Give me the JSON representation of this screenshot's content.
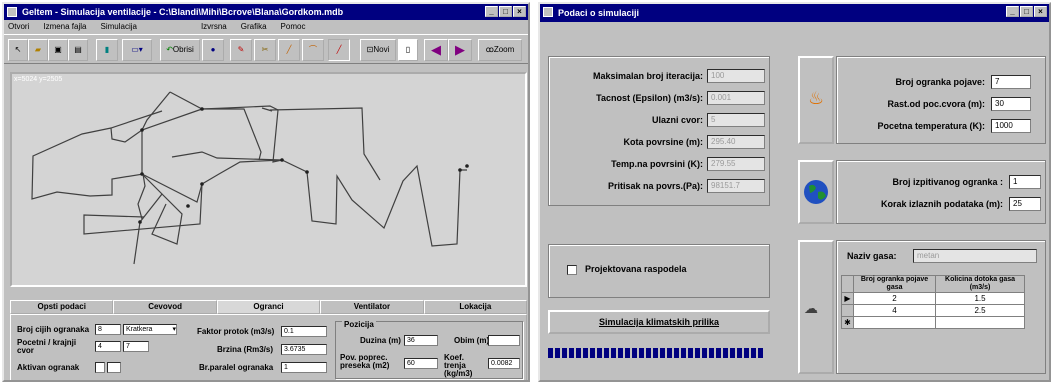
{
  "left_window": {
    "title": "Geltem - Simulacija ventilacije - C:\\Blandi\\Mihi\\Bcrove\\Blana\\Gordkom.mdb",
    "menu": [
      "Otvori",
      "Izmena fajla",
      "Simulacija",
      "Izvrsna",
      "Grafika",
      "Pomoc"
    ],
    "toolbar": {
      "obrisi_label": "Obrisi",
      "novi_label": "Novi",
      "zoom_label": "Zoom"
    },
    "coord_readout": "x=5024 y=2505",
    "tabs": [
      "Opsti podaci",
      "Cevovod",
      "Ogranci",
      "Ventilator",
      "Lokacija"
    ],
    "active_tab": 2,
    "panel": {
      "broj_cijih_ogranaka_label": "Broj cijih ogranaka",
      "broj_cijih_ogranaka_value": "8",
      "combo_value": "Kratkera",
      "pocetni_krajnji_label": "Pocetni / krajnji cvor",
      "pocetni_value": "4",
      "krajnji_value": "7",
      "aktivan_label": "Aktivan ogranak",
      "faktor_label": "Faktor protok (m3/s)",
      "faktor_value": "0.1",
      "brzina_label": "Brzina (Rm3/s)",
      "brzina_value": "3.6735",
      "br_paralel_label": "Br.paralel ogranaka",
      "br_paralel_value": "1",
      "pozicija_label": "Pozicija",
      "duzina_label": "Duzina (m)",
      "duzina_value": "36",
      "obim_label": "Obim (m)",
      "obim_value": "",
      "povrsina_label": "Pov. poprec. preseka (m2)",
      "povrsina_value": "60",
      "koef_label": "Koef. trenja (kg/m3)",
      "koef_value": "0.0082"
    }
  },
  "right_window": {
    "title": "Podaci o simulaciji",
    "fields": [
      {
        "label": "Maksimalan broj iteracija:",
        "value": "100"
      },
      {
        "label": "Tacnost (Epsilon) (m3/s):",
        "value": "0.001"
      },
      {
        "label": "Ulazni cvor:",
        "value": "5"
      },
      {
        "label": "Kota povrsine (m):",
        "value": "295.40"
      },
      {
        "label": "Temp.na povrsini (K):",
        "value": "279.55"
      },
      {
        "label": "Pritisak na povrs.(Pa):",
        "value": "98151.7"
      }
    ],
    "fire": [
      {
        "label": "Broj ogranka pojave:",
        "value": "7"
      },
      {
        "label": "Rast.od poc.cvora (m):",
        "value": "30"
      },
      {
        "label": "Pocetna temperatura (K):",
        "value": "1000"
      }
    ],
    "earth": [
      {
        "label": "Broj izpitivanog ogranka :",
        "value": "1"
      },
      {
        "label": "Korak izlaznih podataka (m):",
        "value": "25"
      }
    ],
    "checkbox_label": "Projektovana raspodela",
    "simulate_button": "Simulacija klimatskih prilika",
    "gas_label": "Naziv gasa:",
    "gas_value": "metan",
    "table_headers": [
      "Broj ogranka pojave gasa",
      "Kolicina dotoka gasa (m3/s)"
    ],
    "table_rows": [
      [
        "2",
        "1.5"
      ],
      [
        "4",
        "2.5"
      ]
    ],
    "progress_fraction": 1.0
  }
}
